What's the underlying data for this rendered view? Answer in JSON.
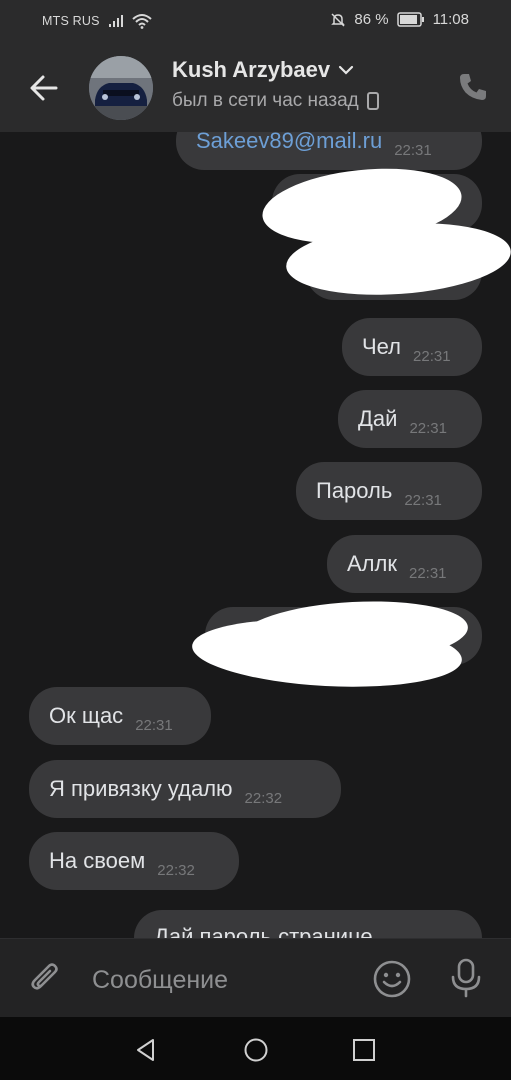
{
  "status_bar": {
    "carrier": "MTS RUS",
    "battery": "86 %",
    "time": "11:08"
  },
  "header": {
    "name": "Kush Arzybaev",
    "status": "был в сети час назад"
  },
  "messages": [
    {
      "text": "Sakeev89@mail.ru",
      "time": "22:31",
      "side": "out"
    },
    {
      "text": "",
      "time": "",
      "side": "out"
    },
    {
      "text": "Чел",
      "time": "22:31",
      "side": "out"
    },
    {
      "text": "Дай",
      "time": "22:31",
      "side": "out"
    },
    {
      "text": "Пароль",
      "time": "22:31",
      "side": "out"
    },
    {
      "text": "Аллк",
      "time": "22:31",
      "side": "out"
    },
    {
      "text": "",
      "time": "",
      "side": "out"
    },
    {
      "text": "Ок щас",
      "time": "22:31",
      "side": "in"
    },
    {
      "text": "Я привязку удалю",
      "time": "22:32",
      "side": "in"
    },
    {
      "text": "На своем",
      "time": "22:32",
      "side": "in"
    },
    {
      "text": "Дай пароль странице",
      "time": "",
      "side": "out"
    }
  ],
  "input": {
    "placeholder": "Сообщение"
  },
  "colors": {
    "background": "#19191a",
    "bubble": "#39393b",
    "header": "#2b2b2c",
    "link": "#6d9fd6"
  }
}
